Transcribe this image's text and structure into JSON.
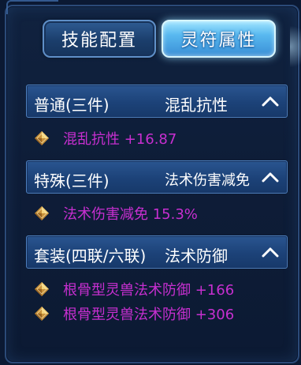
{
  "tabs": [
    {
      "label": "技能配置"
    },
    {
      "label": "灵符属性"
    }
  ],
  "sections": [
    {
      "category": "普通(三件)",
      "attribute": "混乱抗性",
      "stats": [
        "混乱抗性 +16.87"
      ]
    },
    {
      "category": "特殊(三件)",
      "attribute": "法术伤害减免",
      "stats": [
        "法术伤害减免 15.3%"
      ]
    },
    {
      "category": "套装(四联/六联)",
      "attribute": "法术防御",
      "stats": [
        "根骨型灵兽法术防御 +166",
        "根骨型灵兽法术防御 +306"
      ]
    }
  ],
  "icons": {
    "collapse": "chevron-up-icon",
    "stat_bullet": "gold-diamond-icon"
  },
  "colors": {
    "stat_text": "#c72fd0",
    "active_tab": "#58b8ef",
    "section_header": "#1c4278"
  }
}
